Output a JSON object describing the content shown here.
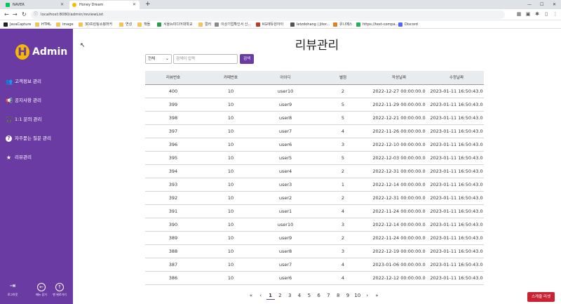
{
  "browser": {
    "tabs": [
      {
        "label": "NAVER",
        "color": "#03c75a"
      },
      {
        "label": "Honey Dream",
        "color": "#f6b800"
      }
    ],
    "url": "localhost:8080/admin/reviewList",
    "bookmarks": [
      {
        "label": "JavaCapture",
        "color": "#222222"
      },
      {
        "label": "HTML",
        "color": "#f2c55c"
      },
      {
        "label": "image",
        "color": "#f2c55c"
      },
      {
        "label": "3D프린팅쇼핑머커",
        "color": "#f2c55c"
      },
      {
        "label": "연성",
        "color": "#f2c55c"
      },
      {
        "label": "책들",
        "color": "#f2c55c"
      },
      {
        "label": "서울뉴미디어대학교",
        "color": "#2a9d4b"
      },
      {
        "label": "컬러",
        "color": "#f2c55c"
      },
      {
        "label": "이상기업확인서 신...",
        "color": "#8a8a8a"
      },
      {
        "label": "KG에듀원아이",
        "color": "#c0392b"
      },
      {
        "label": "letzdohang | Jitor...",
        "color": "#555555"
      },
      {
        "label": "유니메스",
        "color": "#e67e22"
      },
      {
        "label": "https://text-compa...",
        "color": "#27ae60"
      },
      {
        "label": "Discord",
        "color": "#5865f2"
      }
    ]
  },
  "sidebar": {
    "brand_letter": "H",
    "brand": "Admin",
    "items": [
      {
        "label": "고객정보 관리",
        "icon": "users-icon",
        "glyph": "👥"
      },
      {
        "label": "공지사항 관리",
        "icon": "megaphone-icon",
        "glyph": "📢"
      },
      {
        "label": "1:1 문의 관리",
        "icon": "headset-icon",
        "glyph": "🎧"
      },
      {
        "label": "자주묻는 질문 관리",
        "icon": "question-icon",
        "glyph": "?"
      },
      {
        "label": "리뷰관리",
        "icon": "star-icon",
        "glyph": "★"
      }
    ],
    "bottom": [
      {
        "label": "로그아웃",
        "icon": "logout-icon",
        "glyph": "⇥"
      },
      {
        "label": "메뉴 닫기",
        "icon": "arrow-left-circle-icon",
        "glyph": "←"
      },
      {
        "label": "맨 위로가기",
        "icon": "arrow-up-circle-icon",
        "glyph": "↑"
      }
    ]
  },
  "main": {
    "title": "리뷰관리",
    "search": {
      "select_value": "전체",
      "placeholder": "검색어 입력",
      "button": "검색"
    },
    "table": {
      "headers": [
        "리뷰번호",
        "카페번호",
        "아이디",
        "별점",
        "작성날짜",
        "수정날짜"
      ],
      "rows": [
        [
          "400",
          "10",
          "user10",
          "2",
          "2022-12-27 00:00:00.0",
          "2023-01-11 16:50:43.0"
        ],
        [
          "399",
          "10",
          "user9",
          "5",
          "2022-11-29 00:00:00.0",
          "2023-01-11 16:50:43.0"
        ],
        [
          "398",
          "10",
          "user8",
          "5",
          "2022-12-21 00:00:00.0",
          "2023-01-11 16:50:43.0"
        ],
        [
          "397",
          "10",
          "user7",
          "4",
          "2022-11-26 00:00:00.0",
          "2023-01-11 16:50:43.0"
        ],
        [
          "396",
          "10",
          "user6",
          "3",
          "2022-12-10 00:00:00.0",
          "2023-01-11 16:50:43.0"
        ],
        [
          "395",
          "10",
          "user5",
          "5",
          "2022-12-03 00:00:00.0",
          "2023-01-11 16:50:43.0"
        ],
        [
          "394",
          "10",
          "user4",
          "2",
          "2022-12-31 00:00:00.0",
          "2023-01-11 16:50:43.0"
        ],
        [
          "393",
          "10",
          "user3",
          "1",
          "2022-12-14 00:00:00.0",
          "2023-01-11 16:50:43.0"
        ],
        [
          "392",
          "10",
          "user2",
          "2",
          "2022-12-31 00:00:00.0",
          "2023-01-11 16:50:43.0"
        ],
        [
          "391",
          "10",
          "user1",
          "4",
          "2022-11-24 00:00:00.0",
          "2023-01-11 16:50:43.0"
        ],
        [
          "390",
          "10",
          "user10",
          "3",
          "2022-12-14 00:00:00.0",
          "2023-01-11 16:50:43.0"
        ],
        [
          "389",
          "10",
          "user9",
          "2",
          "2022-11-24 00:00:00.0",
          "2023-01-11 16:50:43.0"
        ],
        [
          "388",
          "10",
          "user8",
          "3",
          "2022-12-19 00:00:00.0",
          "2023-01-11 16:50:43.0"
        ],
        [
          "387",
          "10",
          "user7",
          "4",
          "2023-01-06 00:00:00.0",
          "2023-01-11 16:50:43.0"
        ],
        [
          "386",
          "10",
          "user6",
          "4",
          "2022-12-12 00:00:00.0",
          "2023-01-11 16:50:43.0"
        ]
      ]
    },
    "pagination": {
      "first": "«",
      "prev": "‹",
      "pages": [
        "1",
        "2",
        "3",
        "4",
        "5",
        "6",
        "7",
        "8",
        "9",
        "10"
      ],
      "active": "1",
      "next": "›",
      "last": "»"
    },
    "scroll_reset": "스케줄 리셋"
  },
  "colors": {
    "sidebar": "#6a3ba3",
    "accent": "#6a3ba3",
    "logo": "#f6b800",
    "danger": "#c82333"
  }
}
